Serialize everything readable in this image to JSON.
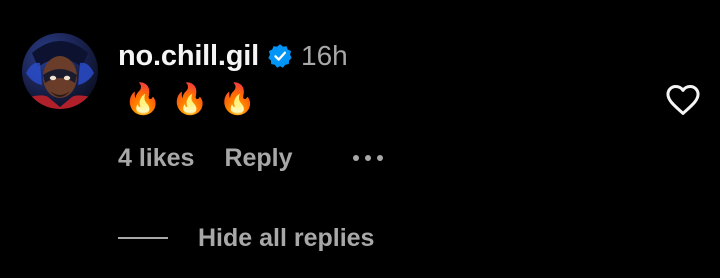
{
  "comment": {
    "username": "no.chill.gil",
    "verified": true,
    "timestamp": "16h",
    "text": "🔥🔥🔥",
    "likes_label": "4 likes",
    "reply_label": "Reply",
    "more_icon": "more-horizontal-icon",
    "like_icon": "heart-outline-icon"
  },
  "replies": {
    "toggle_label": "Hide all replies"
  },
  "colors": {
    "background": "#000000",
    "primary_text": "#f5f5f5",
    "secondary_text": "#a8a8a8",
    "verified_badge": "#0095f6"
  }
}
